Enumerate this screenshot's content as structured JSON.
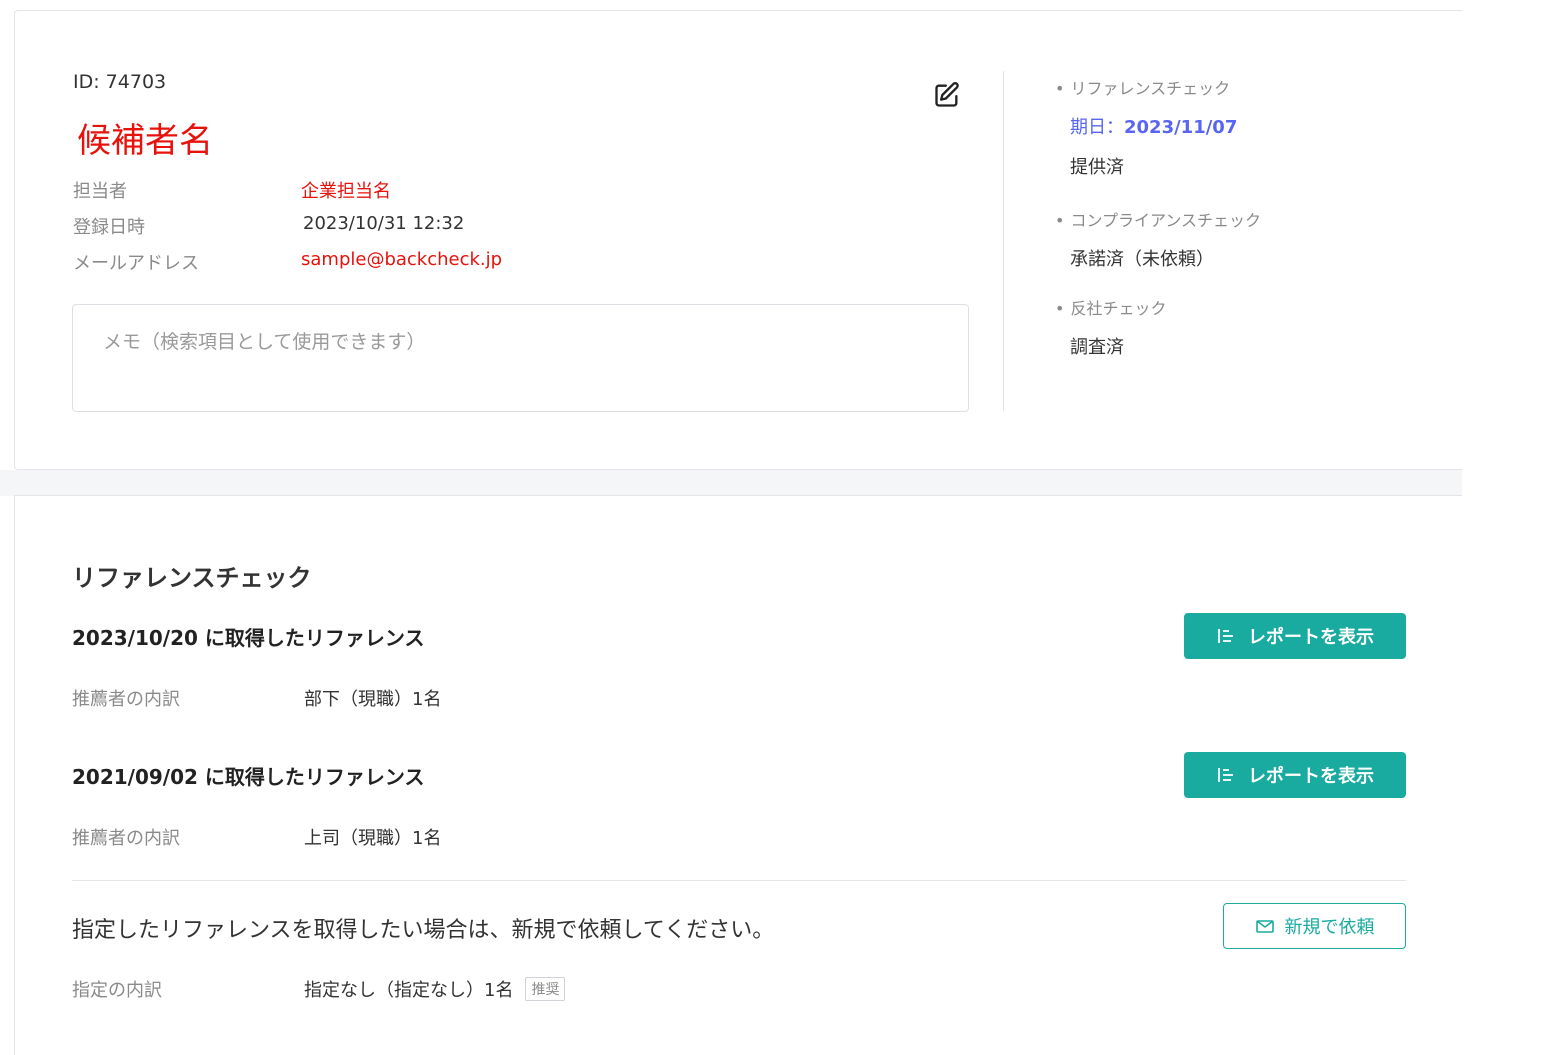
{
  "candidate": {
    "id_label": "ID: 74703",
    "name": "候補者名",
    "fields": {
      "owner_label": "担当者",
      "owner_value": "企業担当名",
      "registered_label": "登録日時",
      "registered_value": "2023/10/31 12:32",
      "email_label": "メールアドレス",
      "email_value": "sample@backcheck.jp"
    },
    "memo_placeholder": "メモ（検索項目として使用できます）"
  },
  "status": {
    "reference": {
      "title": "リファレンスチェック",
      "due_prefix": "期日：",
      "due_date": "2023/11/07",
      "value": "提供済"
    },
    "compliance": {
      "title": "コンプライアンスチェック",
      "value": "承諾済（未依頼）"
    },
    "antisocial": {
      "title": "反社チェック",
      "value": "調査済"
    }
  },
  "reference_section": {
    "title": "リファレンスチェック",
    "references": [
      {
        "heading": "2023/10/20 に取得したリファレンス",
        "detail_label": "推薦者の内訳",
        "detail_value": "部下（現職）1名",
        "button_label": "レポートを表示"
      },
      {
        "heading": "2021/09/02 に取得したリファレンス",
        "detail_label": "推薦者の内訳",
        "detail_value": "上司（現職）1名",
        "button_label": "レポートを表示"
      }
    ],
    "request_text": "指定したリファレンスを取得したい場合は、新規で依頼してください。",
    "new_request_button": "新規で依頼",
    "spec_label": "指定の内訳",
    "spec_value": "指定なし（指定なし）1名",
    "spec_badge": "推奨"
  },
  "colors": {
    "accent_teal": "#1aaba0",
    "highlight_red": "#e8120c",
    "due_blue": "#5865f2"
  },
  "icons": {
    "edit": "edit-icon",
    "report": "report-list-icon",
    "mail": "mail-send-icon"
  }
}
